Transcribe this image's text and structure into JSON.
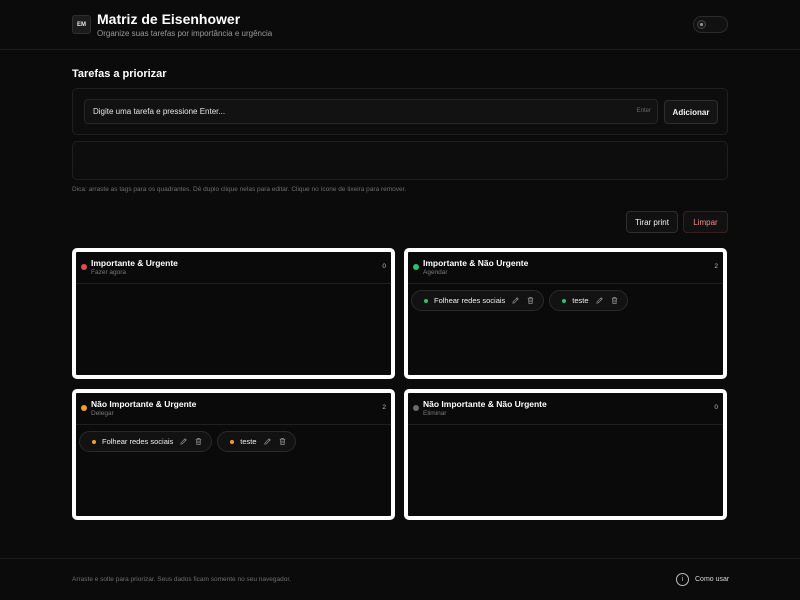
{
  "header": {
    "logo": "EM",
    "title": "Matriz de Eisenhower",
    "subtitle": "Organize suas tarefas por importância e urgência",
    "theme_toggle_icon": "moon-icon"
  },
  "tasks_section": {
    "title": "Tarefas a priorizar",
    "input_placeholder": "Digite uma tarefa e pressione Enter...",
    "input_value": "",
    "enter_hint": "Enter",
    "add_label": "Adicionar",
    "hint": "Dica: arraste as tags para os quadrantes. Dê duplo clique nelas para editar. Clique no ícone de lixeira para remover.",
    "print_label": "Tirar print",
    "clear_label": "Limpar"
  },
  "quadrants": [
    {
      "title": "Importante & Urgente",
      "subtitle": "Fazer agora",
      "count": "0",
      "color": "#e5484d",
      "tasks": []
    },
    {
      "title": "Importante & Não Urgente",
      "subtitle": "Agendar",
      "count": "2",
      "color": "#2fbf71",
      "tasks": [
        {
          "label": "Folhear redes sociais"
        },
        {
          "label": "teste"
        }
      ]
    },
    {
      "title": "Não Importante & Urgente",
      "subtitle": "Delegar",
      "count": "2",
      "color": "#f0a020",
      "tasks": [
        {
          "label": "Folhear redes sociais"
        },
        {
          "label": "teste"
        }
      ]
    },
    {
      "title": "Não Importante & Não Urgente",
      "subtitle": "Eliminar",
      "count": "0",
      "color": "#6b6b6b",
      "tasks": []
    }
  ],
  "footer": {
    "text": "Arraste e solte para priorizar. Seus dados ficam somente no seu navegador.",
    "how_to_label": "Como usar",
    "how_to_icon": "info-icon"
  },
  "colors": {
    "background": "#0b0b0b",
    "danger": "#f08a8a"
  }
}
